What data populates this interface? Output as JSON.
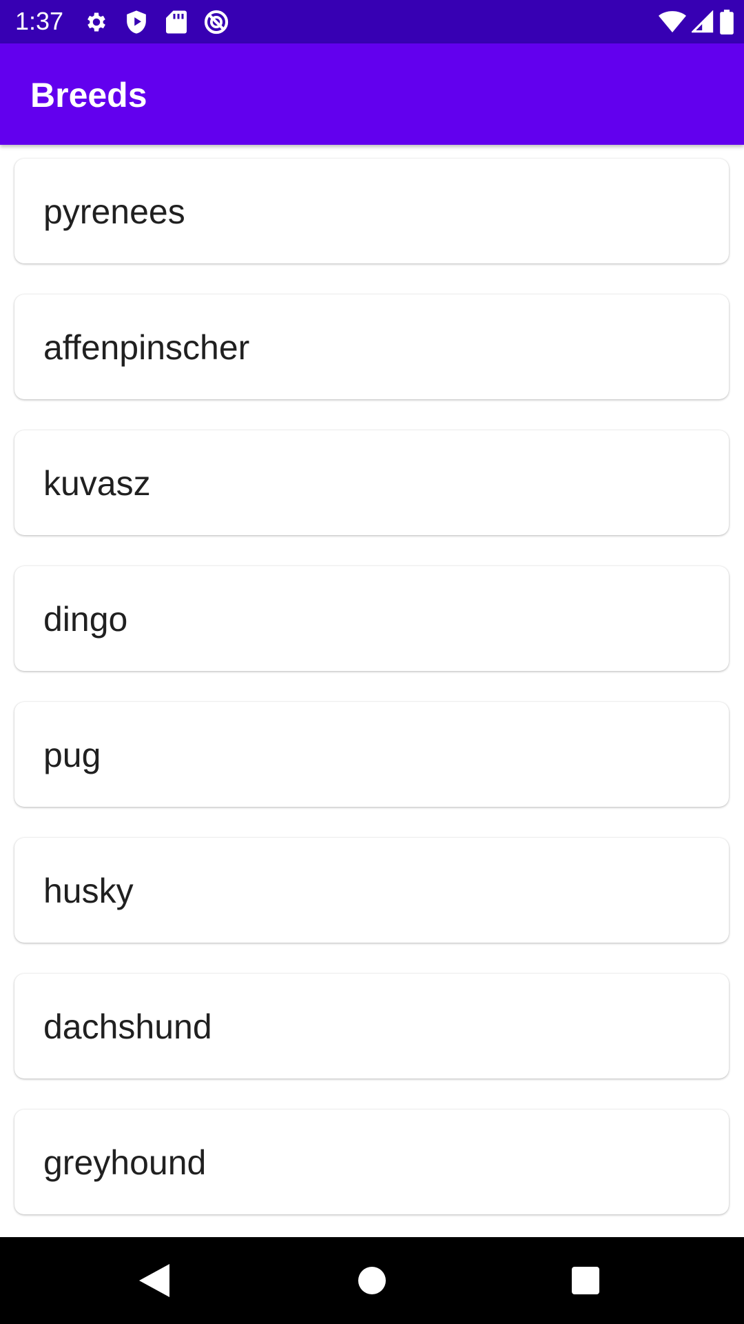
{
  "status_bar": {
    "time": "1:37",
    "left_icons": [
      "settings-icon",
      "play-protect-icon",
      "sd-card-icon",
      "do-not-disturb-icon"
    ],
    "right_icons": [
      "wifi-icon",
      "cell-signal-icon",
      "battery-icon"
    ],
    "background": "#3700b3"
  },
  "app_bar": {
    "title": "Breeds",
    "background": "#6200ee"
  },
  "breeds": [
    {
      "name": "pyrenees"
    },
    {
      "name": "affenpinscher"
    },
    {
      "name": "kuvasz"
    },
    {
      "name": "dingo"
    },
    {
      "name": "pug"
    },
    {
      "name": "husky"
    },
    {
      "name": "dachshund"
    },
    {
      "name": "greyhound"
    }
  ],
  "nav_bar": {
    "buttons": [
      "back-icon",
      "home-icon",
      "recents-icon"
    ]
  }
}
